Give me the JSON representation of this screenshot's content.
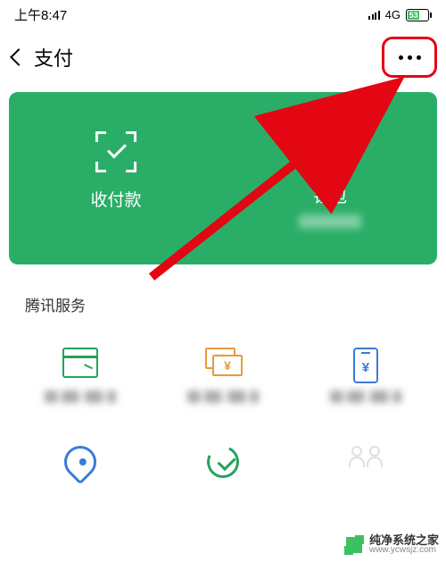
{
  "status": {
    "time": "上午8:47",
    "network": "4G",
    "battery_pct": "53"
  },
  "nav": {
    "title": "支付"
  },
  "green_card": {
    "pay_receive": "收付款",
    "wallet": "钱包"
  },
  "section": {
    "title": "腾讯服务"
  },
  "watermark": {
    "name": "纯净系统之家",
    "url": "www.ycwsjz.com"
  },
  "colors": {
    "primary_green": "#2aae67",
    "highlight_red": "#e30613",
    "blue": "#3b7bd9",
    "orange": "#e89a3c"
  }
}
